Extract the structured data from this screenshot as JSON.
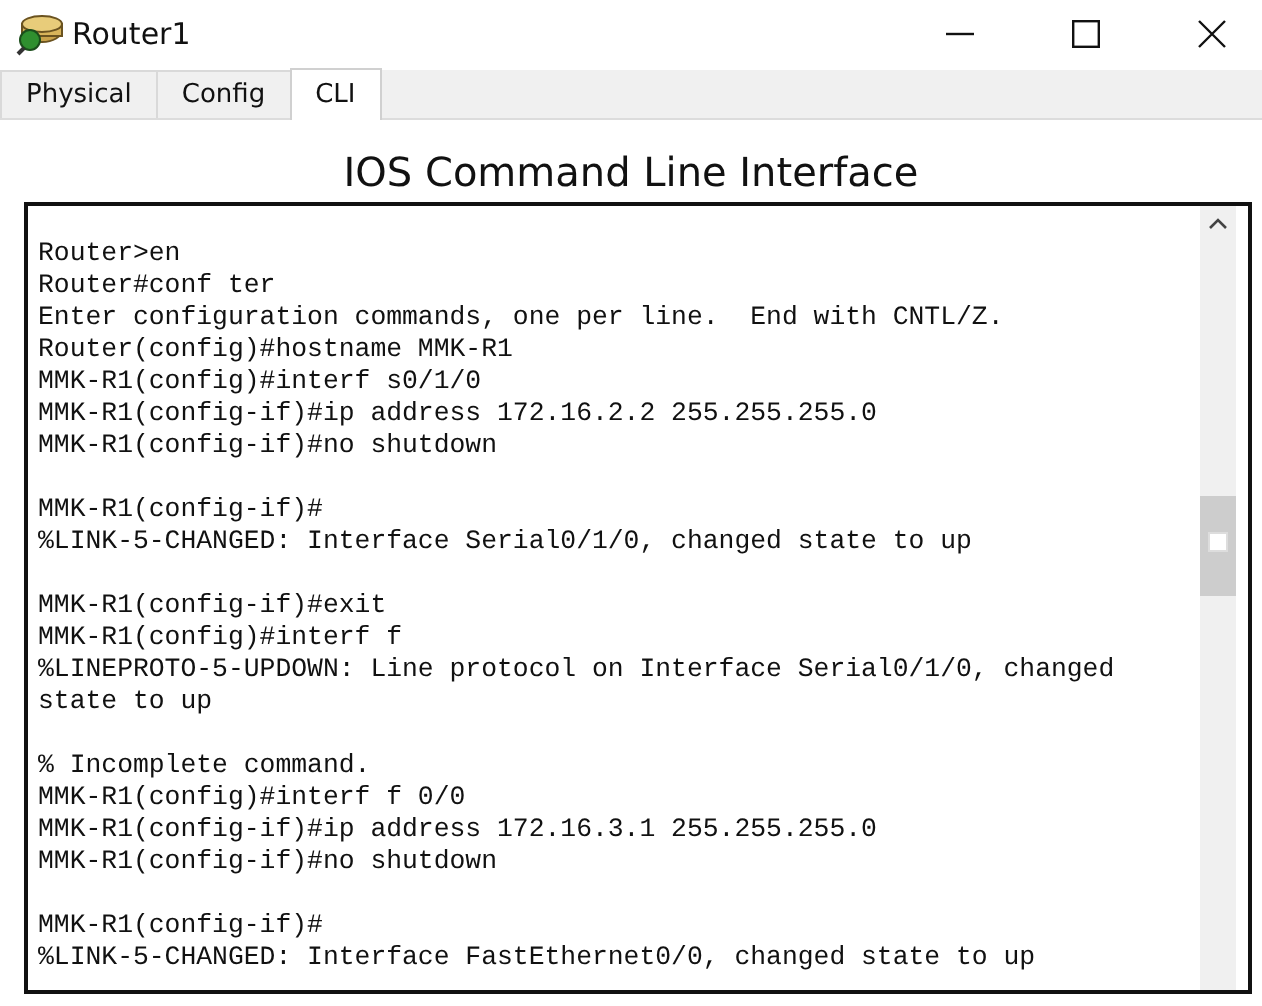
{
  "window": {
    "title": "Router1"
  },
  "tabs": [
    {
      "label": "Physical",
      "selected": false
    },
    {
      "label": "Config",
      "selected": false
    },
    {
      "label": "CLI",
      "selected": true
    }
  ],
  "heading": "IOS Command Line Interface",
  "terminal": {
    "blocks": [
      [
        "Router>en",
        "Router#conf ter",
        "Enter configuration commands, one per line.  End with CNTL/Z.",
        "Router(config)#hostname MMK-R1",
        "MMK-R1(config)#interf s0/1/0",
        "MMK-R1(config-if)#ip address 172.16.2.2 255.255.255.0",
        "MMK-R1(config-if)#no shutdown"
      ],
      [
        "MMK-R1(config-if)#",
        "%LINK-5-CHANGED: Interface Serial0/1/0, changed state to up"
      ],
      [
        "MMK-R1(config-if)#exit",
        "MMK-R1(config)#interf f",
        "%LINEPROTO-5-UPDOWN: Line protocol on Interface Serial0/1/0, changed state to up"
      ],
      [
        "% Incomplete command.",
        "MMK-R1(config)#interf f 0/0",
        "MMK-R1(config-if)#ip address 172.16.3.1 255.255.255.0",
        "MMK-R1(config-if)#no shutdown"
      ],
      [
        "MMK-R1(config-if)#",
        "%LINK-5-CHANGED: Interface FastEthernet0/0, changed state to up"
      ]
    ]
  }
}
